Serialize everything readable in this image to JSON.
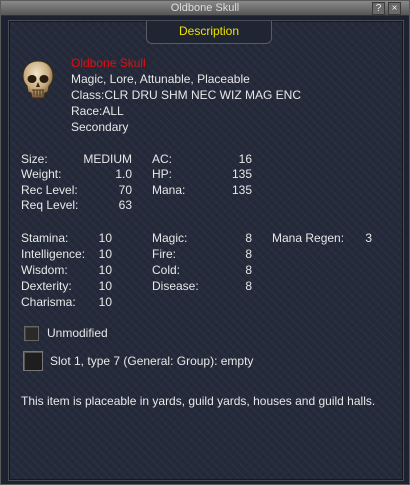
{
  "window": {
    "title": "Oldbone Skull",
    "help_label": "?",
    "close_label": "×"
  },
  "tab": {
    "label": "Description"
  },
  "item": {
    "name": "Oldbone Skull",
    "flags": "Magic, Lore, Attunable, Placeable",
    "class": "Class:CLR DRU SHM NEC WIZ MAG ENC",
    "race": "Race:ALL",
    "slot": "Secondary"
  },
  "stats1": [
    {
      "label": "Size:",
      "value": "MEDIUM"
    },
    {
      "label": "Weight:",
      "value": "1.0"
    },
    {
      "label": "Rec Level:",
      "value": "70"
    },
    {
      "label": "Req Level:",
      "value": "63"
    }
  ],
  "stats2": [
    {
      "label": "AC:",
      "value": "16"
    },
    {
      "label": "HP:",
      "value": "135"
    },
    {
      "label": "Mana:",
      "value": "135"
    }
  ],
  "attrs": [
    {
      "label": "Stamina:",
      "value": "10"
    },
    {
      "label": "Intelligence:",
      "value": "10"
    },
    {
      "label": "Wisdom:",
      "value": "10"
    },
    {
      "label": "Dexterity:",
      "value": "10"
    },
    {
      "label": "Charisma:",
      "value": "10"
    }
  ],
  "resists": [
    {
      "label": "Magic:",
      "value": "8"
    },
    {
      "label": "Fire:",
      "value": "8"
    },
    {
      "label": "Cold:",
      "value": "8"
    },
    {
      "label": "Disease:",
      "value": "8"
    }
  ],
  "extra": {
    "label": "Mana Regen:",
    "value": "3"
  },
  "unmodified": "Unmodified",
  "augment_slot": "Slot 1, type 7 (General: Group): empty",
  "description": "This item is placeable in yards, guild yards, houses and guild halls.",
  "colors": {
    "item_name": "#e01010",
    "tab_text": "#f0e000",
    "text": "#e8e8e8"
  },
  "icons": {
    "item": "skull-icon"
  }
}
